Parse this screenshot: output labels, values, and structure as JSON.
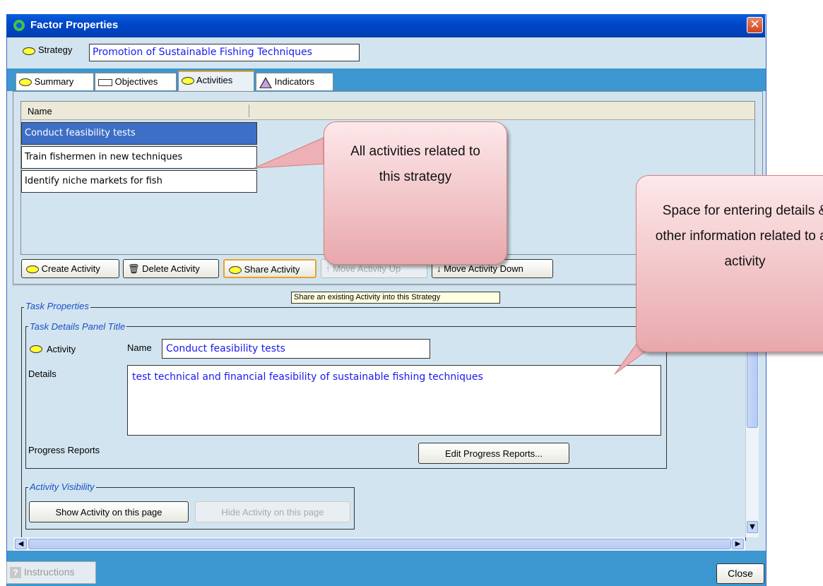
{
  "window": {
    "title": "Factor Properties",
    "close_glyph": "✕"
  },
  "strategy": {
    "label": "Strategy",
    "value": "Promotion of Sustainable Fishing Techniques"
  },
  "tabs": [
    {
      "label": "Summary",
      "icon": "strategy-ellipse-icon"
    },
    {
      "label": "Objectives",
      "icon": "objective-rect-icon"
    },
    {
      "label": "Activities",
      "icon": "activity-ellipse-icon",
      "active": true
    },
    {
      "label": "Indicators",
      "icon": "indicator-triangle-icon"
    }
  ],
  "activities_table": {
    "header": "Name",
    "rows": [
      {
        "name": "Conduct feasibility tests",
        "selected": true
      },
      {
        "name": "Train fishermen in new techniques"
      },
      {
        "name": "Identify niche markets for fish"
      }
    ]
  },
  "toolbar": {
    "create": "Create Activity",
    "delete": "Delete Activity",
    "share": "Share Activity",
    "move_up": "Move Activity Up",
    "move_down": "Move Activity Down",
    "tooltip": "Share an existing Activity into this Strategy"
  },
  "task_properties": {
    "legend": "Task Properties",
    "details_panel_legend": "Task Details Panel Title",
    "type_label": "Activity",
    "name_label": "Name",
    "name_value": "Conduct feasibility tests",
    "details_label": "Details",
    "details_value": "test technical and financial feasibility of sustainable fishing techniques",
    "progress_label": "Progress Reports",
    "edit_progress_button": "Edit Progress Reports..."
  },
  "visibility": {
    "legend": "Activity Visibility",
    "show_button": "Show Activity on this page",
    "hide_button": "Hide Activity on this page"
  },
  "footer": {
    "instructions": "Instructions",
    "close": "Close"
  },
  "callouts": {
    "activities_note": "All activities related to this strategy",
    "details_note": "Space for entering details & other information related to an activity"
  },
  "colors": {
    "title_bar": "#0a5fe0",
    "panel_bg": "#d2e4ef",
    "tab_strip": "#3c97d0",
    "selected_row": "#3d6fc6",
    "field_text": "#1a1af0",
    "callout_fill": "#f0b8bc"
  }
}
